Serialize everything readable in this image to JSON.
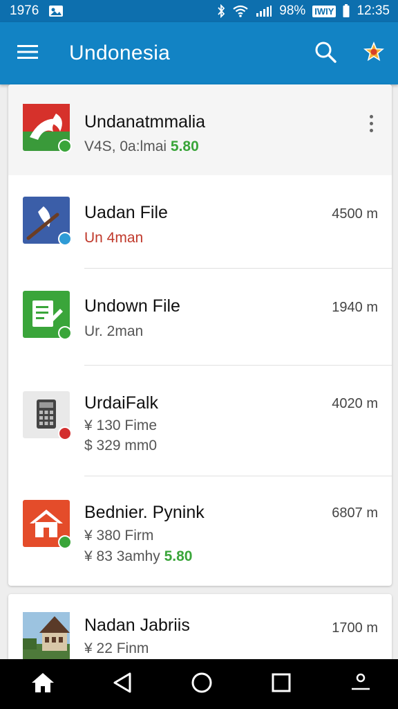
{
  "status_bar": {
    "time_left": "1976",
    "battery": "98%",
    "carrier_badge": "IWIY",
    "clock": "12:35"
  },
  "app_bar": {
    "title": "Undonesia"
  },
  "list": [
    {
      "title": "Undanatmmalia",
      "sub_1": "V4S, 0a:lmai",
      "sub_1_accent": "5.80",
      "meta": ""
    },
    {
      "title": "Uadan File",
      "sub_1": "Un 4man",
      "meta": "4500 m"
    },
    {
      "title": "Undown File",
      "sub_1": "Ur. 2man",
      "meta": "1940 m"
    },
    {
      "title": "UrdaiFalk",
      "sub_1": "¥ 130 Fime",
      "sub_2": "$ 329 mm0",
      "meta": "4020 m"
    },
    {
      "title": "Bednier. Pynink",
      "sub_1": "¥ 380 Firm",
      "sub_2": "¥ 83 3amhy",
      "sub_2_accent": "5.80",
      "meta": "6807 m"
    },
    {
      "title": "Nadan Jabriis",
      "sub_1": "¥ 22 Finm",
      "meta": "1700 m"
    }
  ],
  "colors": {
    "status_bar": "#0d6fae",
    "app_bar": "#1283c4",
    "accent_green": "#3aa53a",
    "accent_red": "#c0392b"
  },
  "icons": {
    "status_left": "image-icon",
    "menu": "hamburger-menu-icon",
    "search": "search-icon",
    "profile": "star-badge-icon",
    "nav_home": "home-icon",
    "nav_back": "back-triangle-icon",
    "nav_circle": "home-circle-icon",
    "nav_square": "recents-square-icon",
    "nav_person": "person-icon"
  }
}
